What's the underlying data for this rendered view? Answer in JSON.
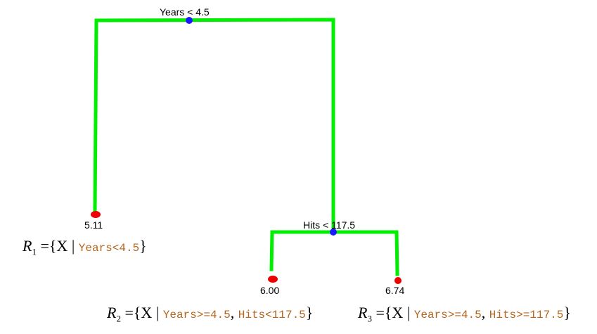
{
  "tree": {
    "root_split": "Years < 4.5",
    "right_split": "Hits < 117.5",
    "leaves": [
      "5.11",
      "6.00",
      "6.74"
    ]
  },
  "regions": [
    {
      "name": "R",
      "sub": "1",
      "eq": "=",
      "open": "{X |",
      "cond": "Years<4.5",
      "close": "}"
    },
    {
      "name": "R",
      "sub": "2",
      "eq": "=",
      "open": "{X |",
      "cond": "Years>=4.5",
      "sep": ",",
      "cond2": "Hits<117.5",
      "close": "}"
    },
    {
      "name": "R",
      "sub": "3",
      "eq": "=",
      "open": "{X |",
      "cond": "Years>=4.5",
      "sep": ",",
      "cond2": "Hits>=117.5",
      "close": "}"
    }
  ],
  "colors": {
    "branch": "#00ee00",
    "split_node": "#1a1aff",
    "leaf_node": "#ee0000"
  }
}
